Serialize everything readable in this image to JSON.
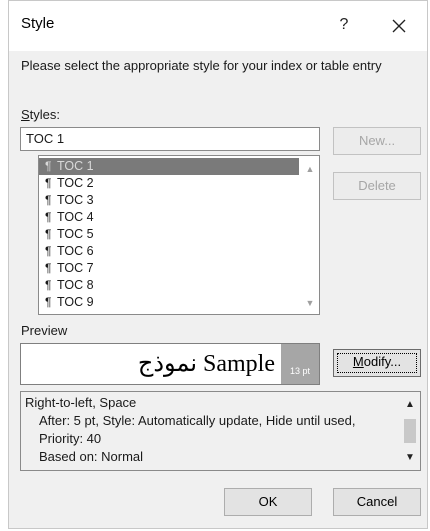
{
  "dialog": {
    "title": "Style",
    "help_label": "?",
    "close_label": "✕"
  },
  "instruction": "Please select the appropriate style for your index or table entry",
  "styles": {
    "label_mnemonic": "S",
    "label_rest": "tyles:",
    "current_value": "TOC 1",
    "items": [
      {
        "label": "TOC 1",
        "selected": true
      },
      {
        "label": "TOC 2",
        "selected": false
      },
      {
        "label": "TOC 3",
        "selected": false
      },
      {
        "label": "TOC 4",
        "selected": false
      },
      {
        "label": "TOC 5",
        "selected": false
      },
      {
        "label": "TOC 6",
        "selected": false
      },
      {
        "label": "TOC 7",
        "selected": false
      },
      {
        "label": "TOC 8",
        "selected": false
      },
      {
        "label": "TOC 9",
        "selected": false
      }
    ],
    "pilcrow": "¶"
  },
  "buttons": {
    "new_label": "New...",
    "delete_label": "Delete",
    "modify_mnemonic": "M",
    "modify_rest": "odify...",
    "ok_label": "OK",
    "cancel_label": "Cancel"
  },
  "preview": {
    "label": "Preview",
    "sample_text": "نموذج Sample",
    "size_badge": "13 pt"
  },
  "description": {
    "line1": "Right-to-left, Space",
    "line2": "After:  5 pt, Style: Automatically update, Hide until used, Priority: 40",
    "line3": "Based on: Normal"
  },
  "colors": {
    "dialog_bg": "#f0f0f0",
    "selected_item_bg": "#7a7a7a",
    "disabled_text": "#a6a6a6"
  }
}
